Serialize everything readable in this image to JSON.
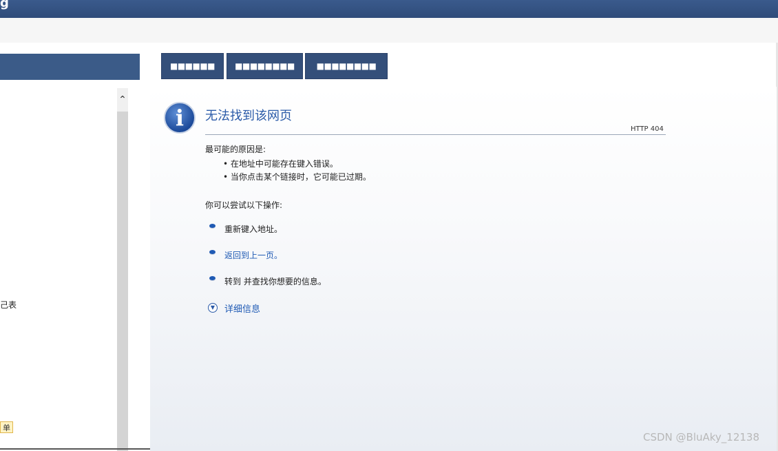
{
  "window": {
    "top_glyph": "g"
  },
  "left_panel": {
    "truncated_text": "己表",
    "badge": "单"
  },
  "tabs": [
    {
      "label": "■■■■■■"
    },
    {
      "label": "■■■■■■■■"
    },
    {
      "label": "■■■■■■■■"
    }
  ],
  "error_page": {
    "title": "无法找到该网页",
    "code": "HTTP 404",
    "reasons_heading": "最可能的原因是:",
    "reasons": [
      "• 在地址中可能存在键入错误。",
      "• 当你点击某个链接时，它可能已过期。"
    ],
    "actions_heading": "你可以尝试以下操作:",
    "actions": [
      "重新键入地址。",
      "返回到上一页。",
      "转到  并查找你想要的信息。"
    ],
    "more_info": "详细信息"
  },
  "watermark": "CSDN @BluAky_12138",
  "icons": {
    "info": "info-icon",
    "scroll_up": "chevron-up-icon",
    "expand": "chevron-down-circle-icon"
  }
}
